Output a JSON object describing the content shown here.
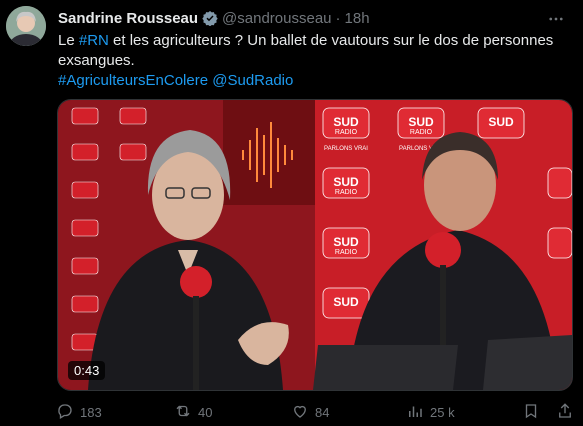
{
  "tweet": {
    "author_name": "Sandrine Rousseau",
    "handle": "@sandrousseau",
    "separator": "·",
    "time": "18h",
    "text_parts": [
      {
        "text": "Le ",
        "link": false
      },
      {
        "text": "#RN",
        "link": true
      },
      {
        "text": " et les agriculteurs ? Un ballet de vautours sur le dos de personnes exsangues.",
        "link": false
      }
    ],
    "tags_line": [
      {
        "text": "#AgriculteursEnColere",
        "link": true
      },
      {
        "text": " ",
        "link": false
      },
      {
        "text": "@SudRadio",
        "link": true
      }
    ]
  },
  "video": {
    "duration": "0:43",
    "brand_primary": "SUD",
    "brand_secondary": "RADIO",
    "slogan": "PARLONS VRAI"
  },
  "actions": {
    "replies": "183",
    "reposts": "40",
    "likes": "84",
    "views": "25 k"
  },
  "colors": {
    "background": "#000000",
    "text": "#e7e9ea",
    "muted": "#71767b",
    "link": "#1d9bf0",
    "brand_red": "#d3202a"
  },
  "icons": {
    "verified": "verified-badge-icon",
    "more": "more-horizontal-icon",
    "reply": "reply-icon",
    "repost": "repost-icon",
    "like": "heart-icon",
    "views": "views-icon",
    "bookmark": "bookmark-icon",
    "share": "share-icon"
  }
}
